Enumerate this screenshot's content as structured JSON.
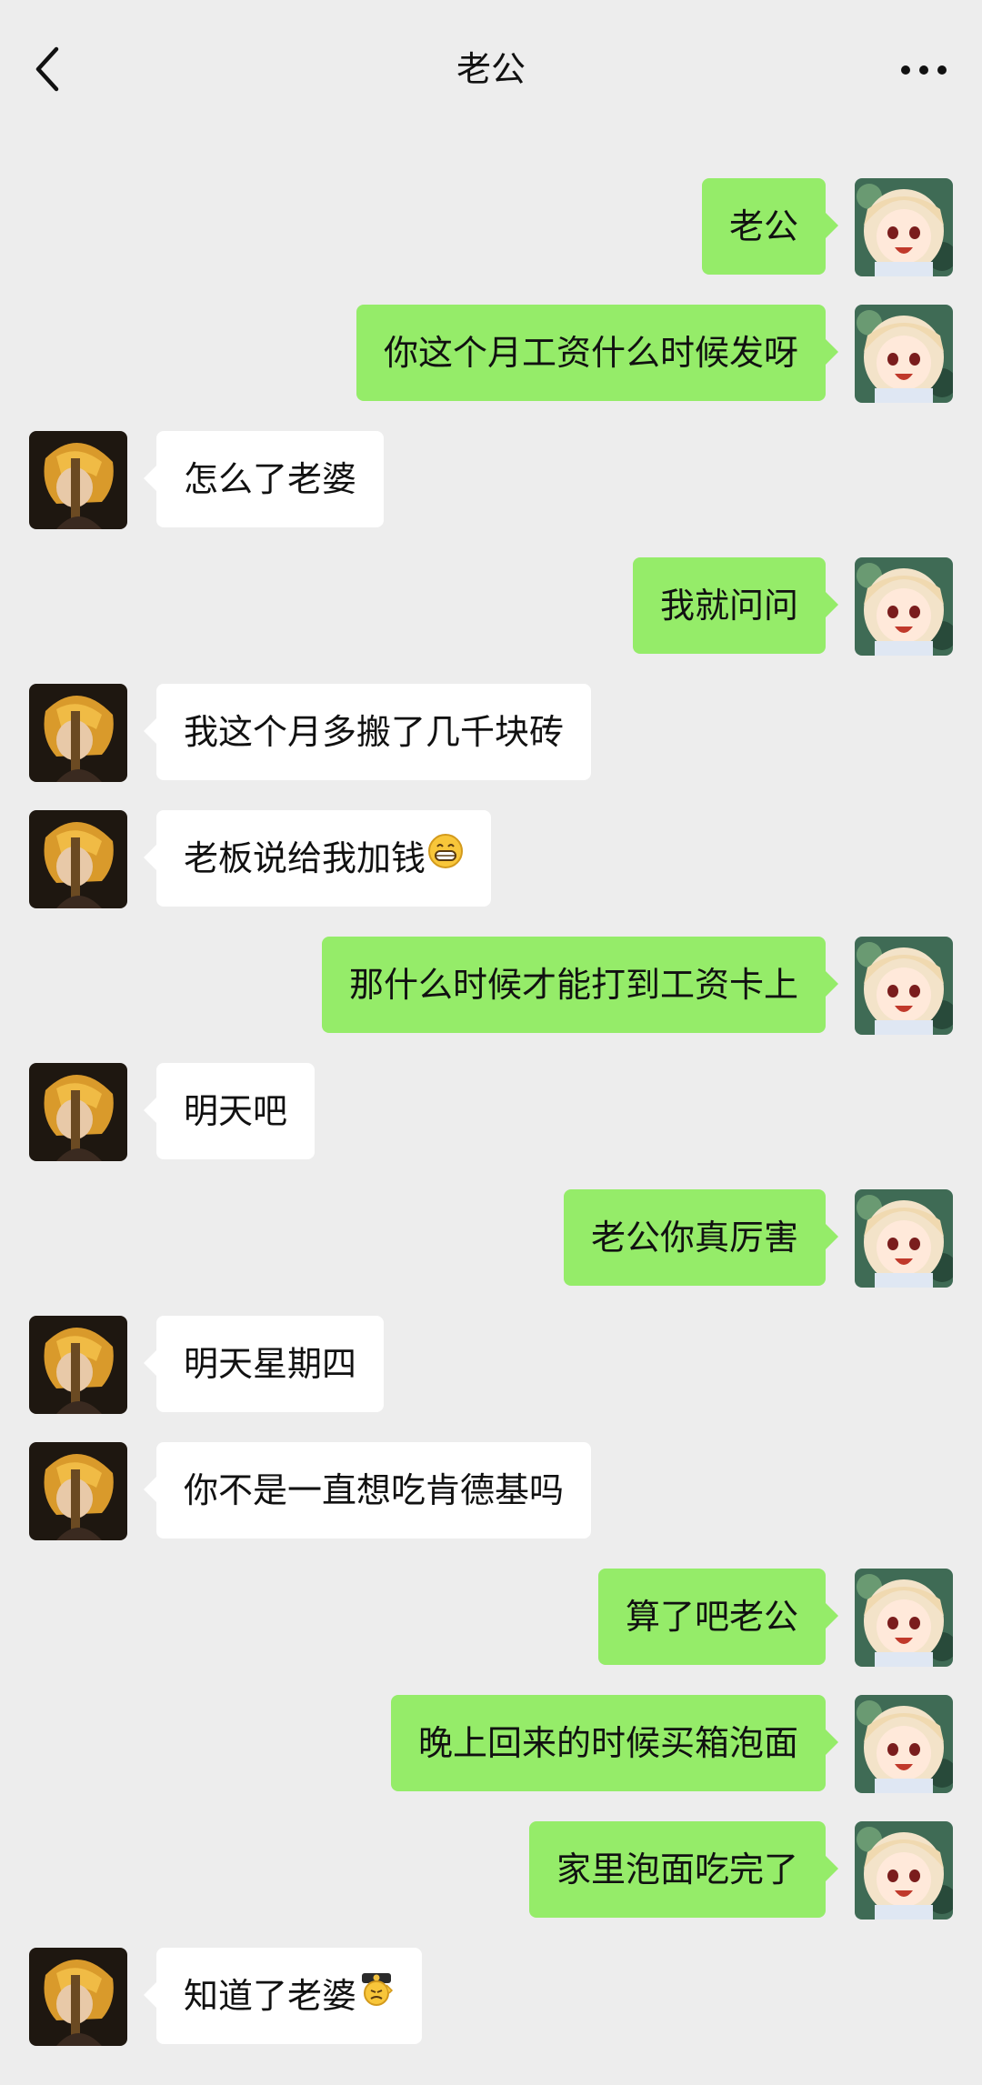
{
  "header": {
    "title": "老公",
    "back_icon": "chevron-left-icon",
    "more_icon": "more-dots-icon"
  },
  "colors": {
    "background": "#ededed",
    "outgoing_bubble": "#95ec69",
    "incoming_bubble": "#ffffff"
  },
  "messages": [
    {
      "side": "out",
      "text": "老公"
    },
    {
      "side": "out",
      "text": "你这个月工资什么时候发呀"
    },
    {
      "side": "in",
      "text": "怎么了老婆"
    },
    {
      "side": "out",
      "text": "我就问问"
    },
    {
      "side": "in",
      "text": "我这个月多搬了几千块砖"
    },
    {
      "side": "in",
      "text": "老板说给我加钱",
      "emoji": "grin-emoji"
    },
    {
      "side": "out",
      "text": "那什么时候才能打到工资卡上"
    },
    {
      "side": "in",
      "text": "明天吧"
    },
    {
      "side": "out",
      "text": "老公你真厉害"
    },
    {
      "side": "in",
      "text": "明天星期四"
    },
    {
      "side": "in",
      "text": "你不是一直想吃肯德基吗"
    },
    {
      "side": "out",
      "text": "算了吧老公"
    },
    {
      "side": "out",
      "text": "晚上回来的时候买箱泡面"
    },
    {
      "side": "out",
      "text": "家里泡面吃完了"
    },
    {
      "side": "in",
      "text": "知道了老婆",
      "emoji": "salute-emoji"
    }
  ]
}
